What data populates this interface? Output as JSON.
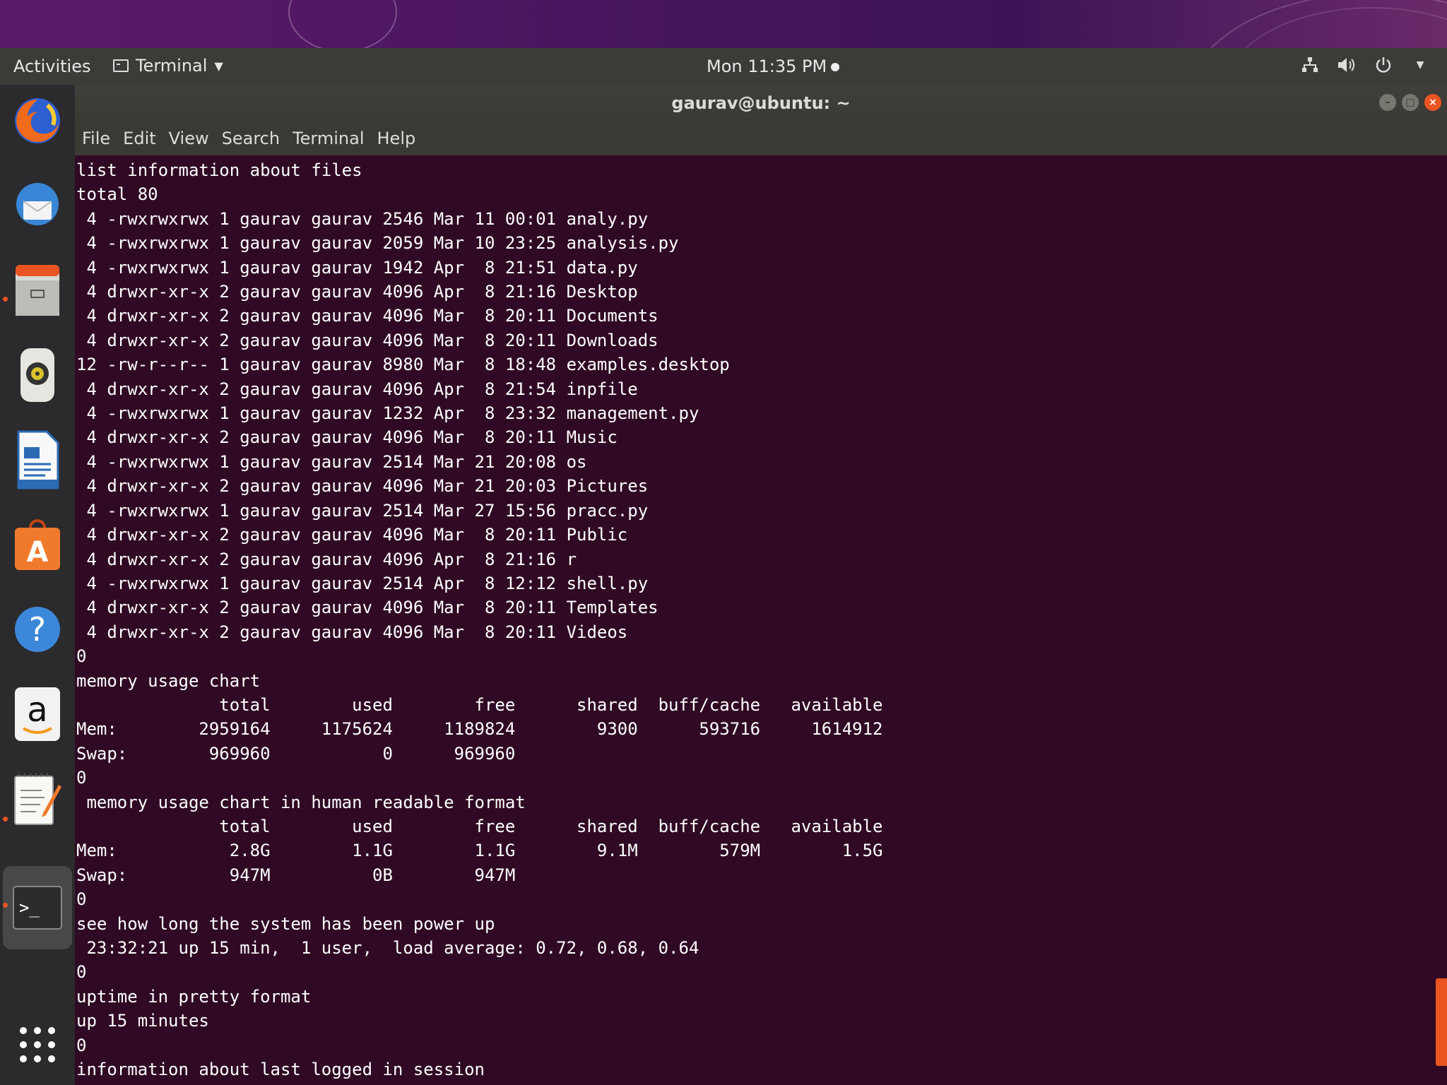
{
  "topbar": {
    "activities": "Activities",
    "app_name": "Terminal",
    "clock": "Mon 11:35 PM"
  },
  "dock": {
    "items": [
      {
        "name": "Firefox",
        "icon": "firefox-icon"
      },
      {
        "name": "Thunderbird",
        "icon": "thunderbird-icon"
      },
      {
        "name": "Files",
        "icon": "files-icon"
      },
      {
        "name": "Rhythmbox",
        "icon": "rhythmbox-icon"
      },
      {
        "name": "LibreOffice Writer",
        "icon": "writer-icon"
      },
      {
        "name": "Ubuntu Software",
        "icon": "software-icon"
      },
      {
        "name": "Help",
        "icon": "help-icon"
      },
      {
        "name": "Amazon",
        "icon": "amazon-icon"
      },
      {
        "name": "Text Editor",
        "icon": "text-editor-icon"
      },
      {
        "name": "Terminal",
        "icon": "terminal-icon"
      },
      {
        "name": "Show Applications",
        "icon": "app-grid-icon"
      }
    ],
    "amazon_glyph": "a",
    "help_glyph": "?",
    "software_glyph": "A",
    "terminal_glyph": ">_"
  },
  "window": {
    "title": "gaurav@ubuntu: ~",
    "menu": [
      "File",
      "Edit",
      "View",
      "Search",
      "Terminal",
      "Help"
    ]
  },
  "terminal_lines": [
    "list information about files",
    "total 80",
    " 4 -rwxrwxrwx 1 gaurav gaurav 2546 Mar 11 00:01 analy.py",
    " 4 -rwxrwxrwx 1 gaurav gaurav 2059 Mar 10 23:25 analysis.py",
    " 4 -rwxrwxrwx 1 gaurav gaurav 1942 Apr  8 21:51 data.py",
    " 4 drwxr-xr-x 2 gaurav gaurav 4096 Apr  8 21:16 Desktop",
    " 4 drwxr-xr-x 2 gaurav gaurav 4096 Mar  8 20:11 Documents",
    " 4 drwxr-xr-x 2 gaurav gaurav 4096 Mar  8 20:11 Downloads",
    "12 -rw-r--r-- 1 gaurav gaurav 8980 Mar  8 18:48 examples.desktop",
    " 4 drwxr-xr-x 2 gaurav gaurav 4096 Apr  8 21:54 inpfile",
    " 4 -rwxrwxrwx 1 gaurav gaurav 1232 Apr  8 23:32 management.py",
    " 4 drwxr-xr-x 2 gaurav gaurav 4096 Mar  8 20:11 Music",
    " 4 -rwxrwxrwx 1 gaurav gaurav 2514 Mar 21 20:08 os",
    " 4 drwxr-xr-x 2 gaurav gaurav 4096 Mar 21 20:03 Pictures",
    " 4 -rwxrwxrwx 1 gaurav gaurav 2514 Mar 27 15:56 pracc.py",
    " 4 drwxr-xr-x 2 gaurav gaurav 4096 Mar  8 20:11 Public",
    " 4 drwxr-xr-x 2 gaurav gaurav 4096 Apr  8 21:16 r",
    " 4 -rwxrwxrwx 1 gaurav gaurav 2514 Apr  8 12:12 shell.py",
    " 4 drwxr-xr-x 2 gaurav gaurav 4096 Mar  8 20:11 Templates",
    " 4 drwxr-xr-x 2 gaurav gaurav 4096 Mar  8 20:11 Videos",
    "0",
    "memory usage chart",
    "              total        used        free      shared  buff/cache   available",
    "Mem:        2959164     1175624     1189824        9300      593716     1614912",
    "Swap:        969960           0      969960",
    "0",
    " memory usage chart in human readable format",
    "              total        used        free      shared  buff/cache   available",
    "Mem:           2.8G        1.1G        1.1G        9.1M        579M        1.5G",
    "Swap:          947M          0B        947M",
    "0",
    "see how long the system has been power up",
    " 23:32:21 up 15 min,  1 user,  load average: 0.72, 0.68, 0.64",
    "0",
    "uptime in pretty format",
    "up 15 minutes",
    "0",
    "information about last logged in session"
  ],
  "colors": {
    "terminal_bg": "#300a24",
    "accent": "#e95420",
    "topbar_bg": "#3b3b38",
    "dock_bg": "#2b2a2c"
  }
}
